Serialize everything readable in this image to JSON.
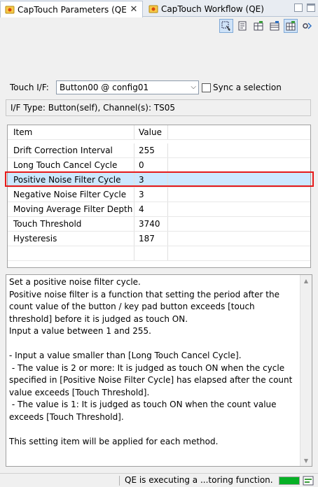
{
  "tabs": [
    {
      "label": "CapTouch Parameters (QE)",
      "close": "✕",
      "icon": "captouch-icon"
    },
    {
      "label": "CapTouch Workflow (QE)",
      "icon": "captouch-icon"
    }
  ],
  "toolbar": {
    "icons": [
      "select-pressed-icon",
      "document-icon",
      "grid-icon",
      "table-icon",
      "grid-pressed-icon",
      "settings-icon"
    ]
  },
  "touch_if": {
    "label": "Touch I/F:",
    "value": "Button00 @ config01",
    "sync_label": "Sync a selection"
  },
  "if_type": "I/F Type: Button(self), Channel(s): TS05",
  "table": {
    "headers": [
      "Item",
      "Value"
    ],
    "rows": [
      {
        "item": "Drift Correction Interval",
        "value": "255"
      },
      {
        "item": "Long Touch Cancel Cycle",
        "value": "0"
      },
      {
        "item": "Positive Noise Filter Cycle",
        "value": "3"
      },
      {
        "item": "Negative Noise Filter Cycle",
        "value": "3"
      },
      {
        "item": "Moving Average Filter Depth",
        "value": "4"
      },
      {
        "item": "Touch Threshold",
        "value": "3740"
      },
      {
        "item": "Hysteresis",
        "value": "187"
      }
    ],
    "selected_index": 2
  },
  "description": "Set a positive noise filter cycle.\nPositive noise filter is a function that setting the period after the count value of the button / key pad button exceeds [touch threshold] before it is judged as touch ON.\nInput a value between 1 and 255.\n\n- Input a value smaller than [Long Touch Cancel Cycle].\n - The value is 2 or more: It is judged as touch ON when the cycle specified in [Positive Noise Filter Cycle] has elapsed after the count value exceeds [Touch Threshold].\n - The value is 1: It is judged as touch ON when the count value exceeds [Touch Threshold].\n\nThis setting item will be applied for each method.",
  "status": {
    "text": "QE is executing a ...toring function.",
    "progress": 1.0,
    "progress_color": "#06b025"
  },
  "colors": {
    "selection": "#cce8ff",
    "highlight": "#e61a1a"
  }
}
